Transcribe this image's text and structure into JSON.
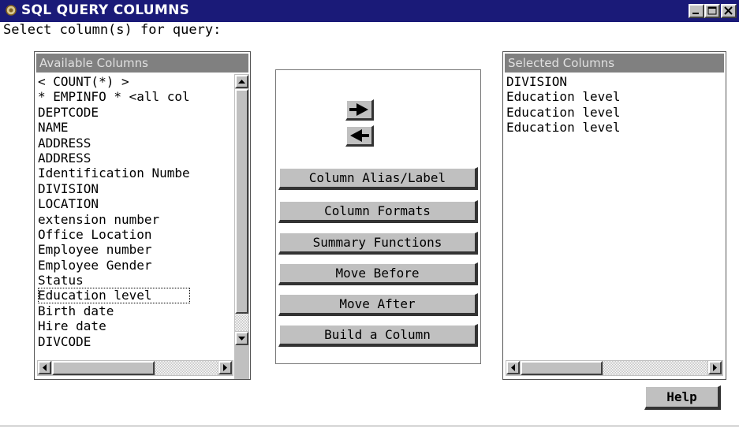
{
  "window": {
    "title": "SQL QUERY COLUMNS",
    "icon": "sas-app-icon",
    "controls": [
      "minimize-icon",
      "maximize-icon",
      "close-icon"
    ]
  },
  "prompt": "Select column(s) for query:",
  "available": {
    "header": "Available Columns",
    "items": [
      "< COUNT(*) >",
      "* EMPINFO * <all col",
      "DEPTCODE",
      "NAME",
      "ADDRESS",
      "ADDRESS",
      "Identification Numbe",
      "DIVISION",
      "LOCATION",
      "extension number",
      "Office Location",
      "Employee number",
      "Employee Gender",
      "Status",
      "Education level",
      "Birth date",
      "Hire date",
      "DIVCODE"
    ],
    "selected_item": "Education level"
  },
  "selected": {
    "header": "Selected Columns",
    "items": [
      "DIVISION",
      "Education level",
      "Education level",
      "Education level"
    ]
  },
  "actions": {
    "add_icon": "right-arrow-icon",
    "remove_icon": "left-arrow-icon",
    "column_alias": "Column Alias/Label",
    "column_formats": "Column Formats",
    "summary_functions": "Summary Functions",
    "move_before": "Move Before",
    "move_after": "Move After",
    "build_column": "Build a Column"
  },
  "help": "Help",
  "colors": {
    "titlebar": "#1a1a78",
    "button_face": "#c0c0c0",
    "header_bg": "#808080"
  }
}
